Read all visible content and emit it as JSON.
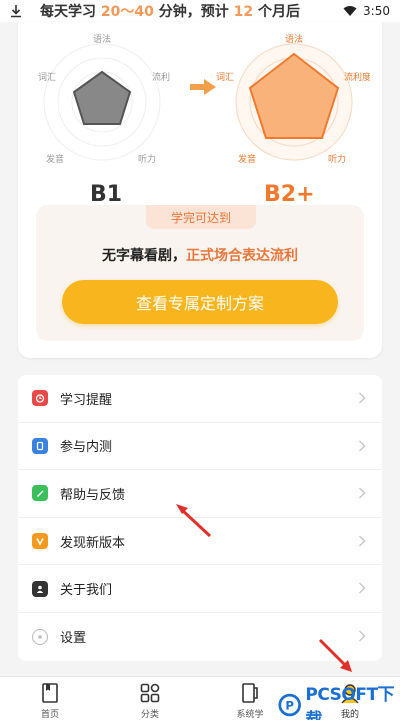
{
  "status_bar": {
    "banner_pre": "每天学习 ",
    "banner_minutes": "20～40",
    "banner_mid": " 分钟，预计 ",
    "banner_months": "12",
    "banner_post": " 个月后",
    "time": "3:50"
  },
  "radar": {
    "axes": [
      "语法",
      "流利度",
      "听力",
      "发音",
      "词汇"
    ],
    "current_level": "B1",
    "target_level": "B2+"
  },
  "achieve": {
    "tag": "学完可达到",
    "text_pre": "无字幕看剧，",
    "text_highlight": "正式场合表达流利",
    "cta_label": "查看专属定制方案"
  },
  "menu": {
    "items": [
      {
        "label": "学习提醒",
        "icon": "alarm-icon",
        "color": "#e84a4a"
      },
      {
        "label": "参与内测",
        "icon": "beta-icon",
        "color": "#3b82e0"
      },
      {
        "label": "帮助与反馈",
        "icon": "pencil-icon",
        "color": "#3bbf5a"
      },
      {
        "label": "发现新版本",
        "icon": "version-icon",
        "color": "#f59a1e"
      },
      {
        "label": "关于我们",
        "icon": "about-icon",
        "color": "#333333"
      },
      {
        "label": "设置",
        "icon": "settings-icon",
        "color": "#bbbbbb"
      }
    ]
  },
  "tabbar": {
    "tabs": [
      {
        "label": "首页",
        "icon": "book-icon"
      },
      {
        "label": "分类",
        "icon": "grid-icon"
      },
      {
        "label": "系统学",
        "icon": "notebook-icon"
      },
      {
        "label": "我的",
        "icon": "profile-icon"
      }
    ]
  },
  "watermark": {
    "text": "PCSOFT",
    "suffix": "下载"
  },
  "colors": {
    "accent_orange": "#ef7a2e",
    "cta_yellow": "#f9b51e"
  }
}
